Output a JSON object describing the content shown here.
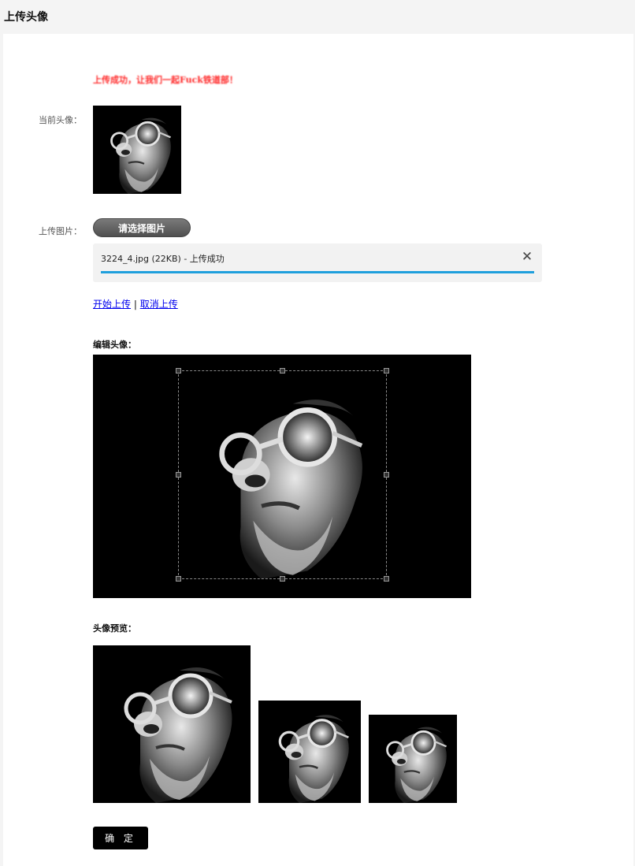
{
  "page": {
    "title": "上传头像"
  },
  "status": {
    "message": "上传成功，让我们一起Fuck铁道部！"
  },
  "current_avatar": {
    "label": "当前头像："
  },
  "upload": {
    "label": "上传图片：",
    "choose_button": "请选择图片",
    "file": {
      "text": "3224_4.jpg (22KB) - 上传成功",
      "progress": 1.0,
      "progress_color": "#1e9fdc",
      "close_icon": "close-icon"
    },
    "start_link": "开始上传",
    "separator": "|",
    "cancel_link": "取消上传"
  },
  "editor": {
    "label": "编辑头像："
  },
  "preview": {
    "label": "头像预览："
  },
  "confirm_button": "确 定",
  "colors": {
    "status_red": "#ff2a2a",
    "link_blue": "#0000ee",
    "button_dark": "#000000"
  }
}
